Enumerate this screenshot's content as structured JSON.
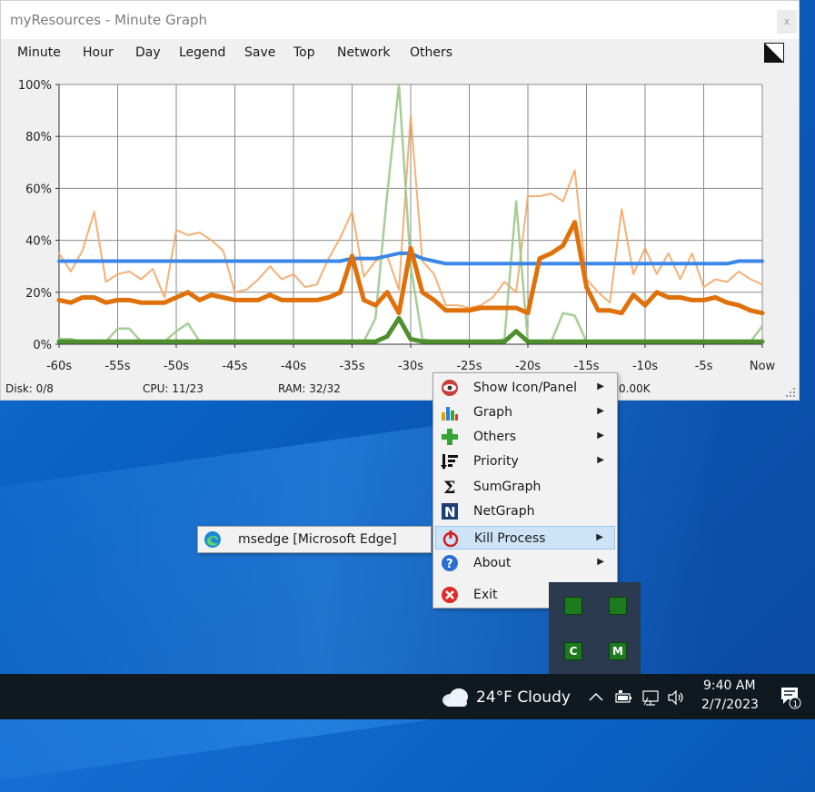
{
  "window": {
    "title": "myResources - Minute Graph",
    "close_label": "x"
  },
  "menu": [
    "Minute",
    "Hour",
    "Day",
    "Legend",
    "Save",
    "Top",
    "Network",
    "Others"
  ],
  "status": {
    "disk": "Disk: 0/8",
    "cpu": "CPU: 11/23",
    "ram": "RAM: 32/32",
    "net_partial": "0.00K"
  },
  "chart_data": {
    "type": "line",
    "x_ticks": [
      "-60s",
      "-55s",
      "-50s",
      "-45s",
      "-40s",
      "-35s",
      "-30s",
      "-25s",
      "-20s",
      "-15s",
      "-10s",
      "-5s",
      "Now"
    ],
    "y_ticks": [
      "100%",
      "80%",
      "60%",
      "40%",
      "20%",
      "0%"
    ],
    "ylim": [
      0,
      100
    ],
    "grid": true,
    "x": [
      -60,
      -59,
      -58,
      -57,
      -56,
      -55,
      -54,
      -53,
      -52,
      -51,
      -50,
      -49,
      -48,
      -47,
      -46,
      -45,
      -44,
      -43,
      -42,
      -41,
      -40,
      -39,
      -38,
      -37,
      -36,
      -35,
      -34,
      -33,
      -32,
      -31,
      -30,
      -29,
      -28,
      -27,
      -26,
      -25,
      -24,
      -23,
      -22,
      -21,
      -20,
      -19,
      -18,
      -17,
      -16,
      -15,
      -14,
      -13,
      -12,
      -11,
      -10,
      -9,
      -8,
      -7,
      -6,
      -5,
      -4,
      -3,
      -2,
      -1,
      0
    ],
    "series": [
      {
        "color": "#3b87e8",
        "values": [
          32,
          32,
          32,
          32,
          32,
          32,
          32,
          32,
          32,
          32,
          32,
          32,
          32,
          32,
          32,
          32,
          32,
          32,
          32,
          32,
          32,
          32,
          32,
          32,
          32,
          33,
          33,
          33,
          34,
          35,
          35,
          33,
          32,
          31,
          31,
          31,
          31,
          31,
          31,
          31,
          31,
          31,
          31,
          31,
          31,
          31,
          31,
          31,
          31,
          31,
          31,
          31,
          31,
          31,
          31,
          31,
          31,
          31,
          32,
          32,
          32
        ]
      },
      {
        "color": "#e0710a",
        "values": [
          17,
          16,
          18,
          18,
          16,
          17,
          17,
          16,
          16,
          16,
          18,
          20,
          17,
          19,
          18,
          17,
          17,
          17,
          19,
          17,
          17,
          17,
          17,
          18,
          20,
          34,
          17,
          15,
          20,
          12,
          37,
          20,
          17,
          13,
          13,
          13,
          14,
          14,
          14,
          14,
          12,
          33,
          35,
          38,
          47,
          22,
          13,
          13,
          12,
          19,
          15,
          20,
          18,
          18,
          17,
          17,
          18,
          16,
          15,
          13,
          12
        ]
      },
      {
        "color": "#f3a766",
        "values": [
          35,
          28,
          36,
          51,
          24,
          27,
          28,
          25,
          29,
          18,
          44,
          42,
          43,
          40,
          36,
          20,
          21,
          25,
          30,
          25,
          27,
          22,
          23,
          33,
          41,
          51,
          26,
          32,
          34,
          21,
          88,
          32,
          27,
          15,
          15,
          14,
          15,
          18,
          24,
          20,
          57,
          57,
          58,
          55,
          67,
          25,
          20,
          16,
          52,
          27,
          37,
          27,
          35,
          25,
          35,
          22,
          25,
          24,
          28,
          25,
          23
        ]
      },
      {
        "color": "#9cc98a",
        "values": [
          2,
          2,
          1,
          1,
          1,
          6,
          6,
          1,
          1,
          1,
          5,
          8,
          1,
          1,
          1,
          1,
          1,
          1,
          1,
          1,
          1,
          1,
          1,
          1,
          1,
          1,
          1,
          10,
          58,
          100,
          30,
          2,
          1,
          1,
          1,
          1,
          1,
          1,
          2,
          55,
          1,
          1,
          1,
          12,
          11,
          1,
          1,
          1,
          1,
          1,
          1,
          1,
          1,
          1,
          1,
          1,
          1,
          1,
          1,
          1,
          7
        ]
      },
      {
        "color": "#4f8f2e",
        "values": [
          1,
          1,
          1,
          1,
          1,
          1,
          1,
          1,
          1,
          1,
          1,
          1,
          1,
          1,
          1,
          1,
          1,
          1,
          1,
          1,
          1,
          1,
          1,
          1,
          1,
          1,
          1,
          1,
          3,
          10,
          2,
          1,
          1,
          1,
          1,
          1,
          1,
          1,
          1,
          5,
          1,
          1,
          1,
          1,
          1,
          1,
          1,
          1,
          1,
          1,
          1,
          1,
          1,
          1,
          1,
          1,
          1,
          1,
          1,
          1,
          1
        ]
      }
    ]
  },
  "context_menu": [
    {
      "label": "Show Icon/Panel",
      "icon": "eye-icon",
      "submenu": true
    },
    {
      "label": "Graph",
      "icon": "bar-graph-icon",
      "submenu": true
    },
    {
      "label": "Others",
      "icon": "plus-icon",
      "submenu": true
    },
    {
      "label": "Priority",
      "icon": "priority-icon",
      "submenu": true
    },
    {
      "label": "SumGraph",
      "icon": "sigma-icon",
      "submenu": false
    },
    {
      "label": "NetGraph",
      "icon": "netgraph-icon",
      "submenu": false
    },
    {
      "label": "Kill Process",
      "icon": "power-icon",
      "submenu": true,
      "highlighted": true
    },
    {
      "label": "About",
      "icon": "help-icon",
      "submenu": true
    },
    {
      "label": "Exit",
      "icon": "exit-icon",
      "submenu": false
    }
  ],
  "kill_submenu": {
    "label": "msedge [Microsoft Edge]",
    "icon": "edge-icon"
  },
  "tray_overflow": [
    "C",
    "M"
  ],
  "taskbar": {
    "weather": "24°F  Cloudy",
    "time": "9:40 AM",
    "date": "2/7/2023",
    "notification_count": "1"
  }
}
